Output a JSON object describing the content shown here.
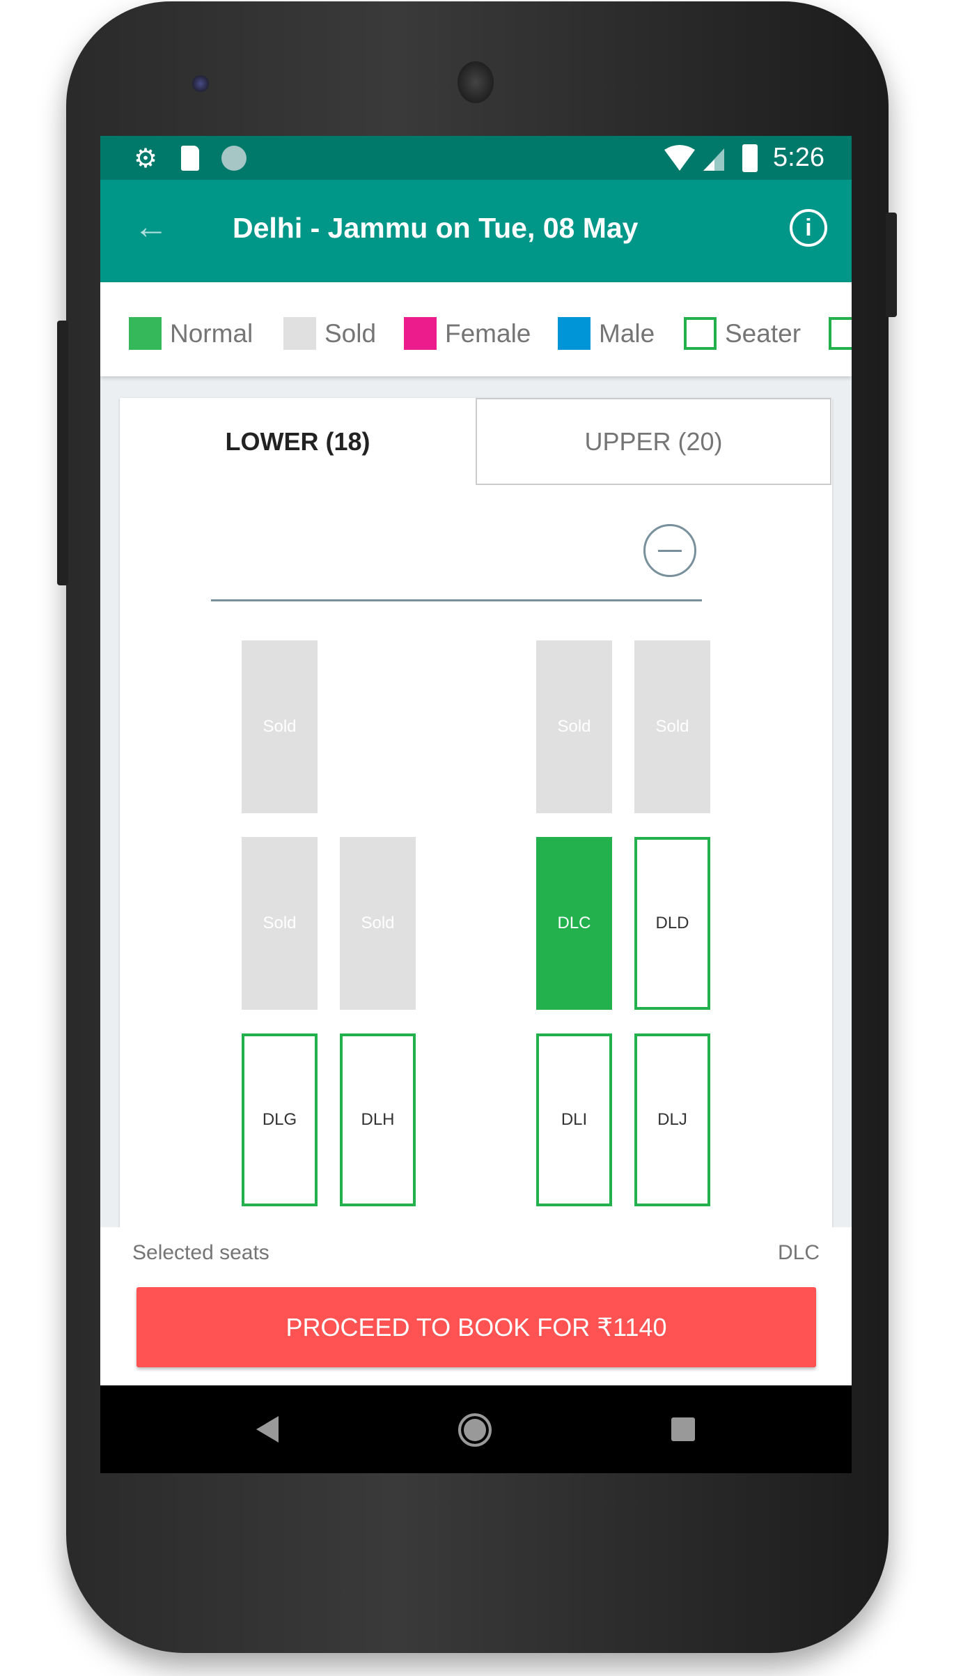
{
  "status_bar": {
    "time": "5:26",
    "icons": [
      "gear-icon",
      "sd-card-icon",
      "sync-icon",
      "wifi-icon",
      "signal-icon",
      "battery-charging-icon"
    ]
  },
  "app_bar": {
    "title": "Delhi - Jammu on Tue, 08 May",
    "back_icon": "arrow-left-icon",
    "info_icon": "info-icon"
  },
  "legend": [
    {
      "label": "Normal",
      "color": "#34b85a"
    },
    {
      "label": "Sold",
      "color": "#e0e0e0"
    },
    {
      "label": "Female",
      "color": "#ec1c8c"
    },
    {
      "label": "Male",
      "color": "#0095d6"
    },
    {
      "label": "Seater",
      "color": "#22b14c"
    }
  ],
  "tabs": [
    {
      "label": "LOWER (18)",
      "active": true
    },
    {
      "label": "UPPER (20)",
      "active": false
    }
  ],
  "seats": [
    {
      "label": "Sold",
      "state": "sold",
      "row": 0,
      "col": 0
    },
    {
      "label": "Sold",
      "state": "sold",
      "row": 0,
      "col": 2
    },
    {
      "label": "Sold",
      "state": "sold",
      "row": 0,
      "col": 3
    },
    {
      "label": "Sold",
      "state": "sold",
      "row": 1,
      "col": 0
    },
    {
      "label": "Sold",
      "state": "sold",
      "row": 1,
      "col": 1
    },
    {
      "label": "DLC",
      "state": "selected",
      "row": 1,
      "col": 2
    },
    {
      "label": "DLD",
      "state": "available",
      "row": 1,
      "col": 3
    },
    {
      "label": "DLG",
      "state": "available",
      "row": 2,
      "col": 0
    },
    {
      "label": "DLH",
      "state": "available",
      "row": 2,
      "col": 1
    },
    {
      "label": "DLI",
      "state": "available",
      "row": 2,
      "col": 2
    },
    {
      "label": "DLJ",
      "state": "available",
      "row": 2,
      "col": 3
    }
  ],
  "footer": {
    "selected_label": "Selected seats",
    "selected_value": "DLC",
    "book_button": "PROCEED TO BOOK FOR ₹1140"
  }
}
